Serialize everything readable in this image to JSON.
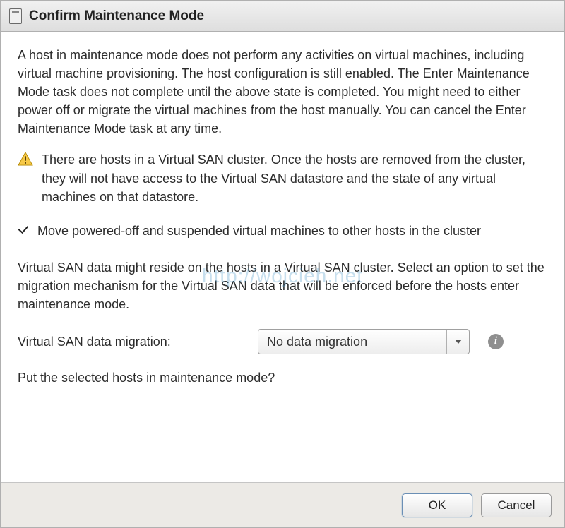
{
  "dialog": {
    "title": "Confirm Maintenance Mode",
    "intro": "A host in maintenance mode does not perform any activities on virtual machines, including virtual machine provisioning. The host configuration is still enabled. The Enter Maintenance Mode task does not complete until the above state is completed. You might need to either power off or migrate the virtual machines from the host manually. You can cancel the Enter Maintenance Mode task at any time.",
    "warning": "There are hosts in a Virtual SAN cluster. Once the hosts are removed from the cluster, they will not have access to the Virtual SAN datastore and the state of any virtual machines on that datastore.",
    "checkbox_label": "Move powered-off and suspended virtual machines to other hosts in the cluster",
    "checkbox_checked": true,
    "vsan_para": "Virtual SAN data might reside on the hosts in a Virtual SAN cluster. Select an option to set the migration mechanism for the Virtual SAN data that will be enforced before the hosts enter maintenance mode.",
    "select_label": "Virtual SAN data migration:",
    "select_value": "No data migration",
    "question": "Put the selected hosts in maintenance mode?",
    "ok_label": "OK",
    "cancel_label": "Cancel"
  },
  "watermark": "http://wojcieh.net"
}
